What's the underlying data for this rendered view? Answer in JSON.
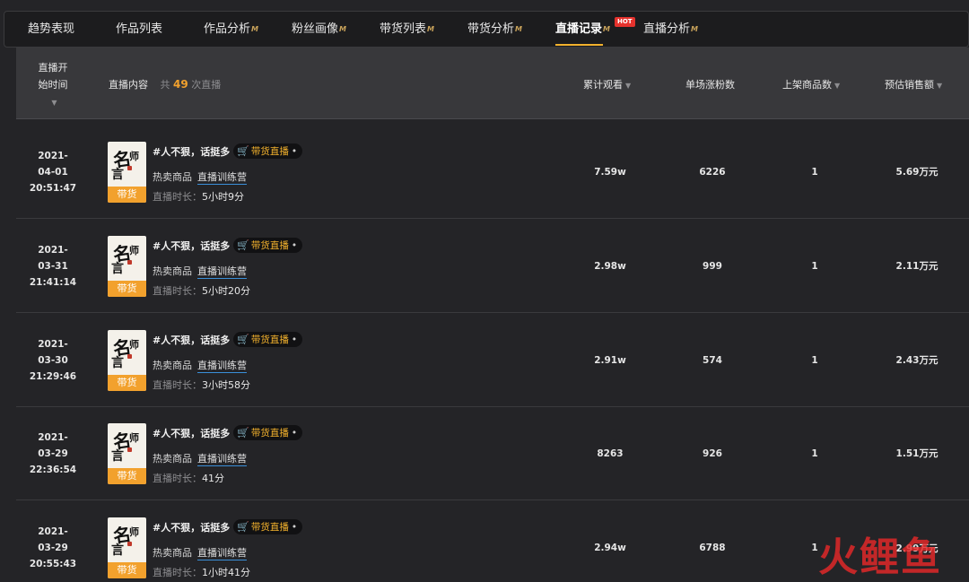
{
  "nav": {
    "tabs": [
      {
        "label": "趋势表现",
        "vip": false,
        "active": false
      },
      {
        "label": "作品列表",
        "vip": false,
        "active": false
      },
      {
        "label": "作品分析",
        "vip": true,
        "active": false
      },
      {
        "label": "粉丝画像",
        "vip": true,
        "active": false
      },
      {
        "label": "带货列表",
        "vip": true,
        "active": false
      },
      {
        "label": "带货分析",
        "vip": true,
        "active": false
      },
      {
        "label": "直播记录",
        "vip": true,
        "active": true
      },
      {
        "label": "直播分析",
        "vip": true,
        "active": false
      }
    ],
    "vip_mark": "M",
    "hot_badge": "HOT"
  },
  "table": {
    "headers": {
      "start_time": "直播开始时间",
      "content": "直播内容",
      "total_prefix": "共",
      "total_count": "49",
      "total_suffix": "次直播",
      "viewers": "累计观看",
      "fans_gain": "单场涨粉数",
      "products": "上架商品数",
      "sales": "预估销售额"
    },
    "caret": "▼",
    "rows": [
      {
        "date": "2021-",
        "md": "04-01",
        "time": "20:51:47",
        "title": "#人不狠，话挺多",
        "pill": "带货直播",
        "hot_label": "热卖商品",
        "hot_link": "直播训练营",
        "dur_label": "直播时长：",
        "duration": "5小时9分",
        "viewers": "7.59w",
        "fans": "6226",
        "products": "1",
        "sales": "5.69万元"
      },
      {
        "date": "2021-",
        "md": "03-31",
        "time": "21:41:14",
        "title": "#人不狠，话挺多",
        "pill": "带货直播",
        "hot_label": "热卖商品",
        "hot_link": "直播训练营",
        "dur_label": "直播时长：",
        "duration": "5小时20分",
        "viewers": "2.98w",
        "fans": "999",
        "products": "1",
        "sales": "2.11万元"
      },
      {
        "date": "2021-",
        "md": "03-30",
        "time": "21:29:46",
        "title": "#人不狠，话挺多",
        "pill": "带货直播",
        "hot_label": "热卖商品",
        "hot_link": "直播训练营",
        "dur_label": "直播时长：",
        "duration": "3小时58分",
        "viewers": "2.91w",
        "fans": "574",
        "products": "1",
        "sales": "2.43万元"
      },
      {
        "date": "2021-",
        "md": "03-29",
        "time": "22:36:54",
        "title": "#人不狠，话挺多",
        "pill": "带货直播",
        "hot_label": "热卖商品",
        "hot_link": "直播训练营",
        "dur_label": "直播时长：",
        "duration": "41分",
        "viewers": "8263",
        "fans": "926",
        "products": "1",
        "sales": "1.51万元"
      },
      {
        "date": "2021-",
        "md": "03-29",
        "time": "20:55:43",
        "title": "#人不狠，话挺多",
        "pill": "带货直播",
        "hot_label": "热卖商品",
        "hot_link": "直播训练营",
        "dur_label": "直播时长：",
        "duration": "1小时41分",
        "viewers": "2.94w",
        "fans": "6788",
        "products": "1",
        "sales": "2.99万元"
      }
    ],
    "thumb": {
      "band": "带货",
      "chars": [
        "名",
        "师",
        "言"
      ]
    }
  },
  "watermark": "火鲤鱼",
  "colors": {
    "accent": "#f2b12d",
    "hot": "#e5322d",
    "link_underline": "#3a8fd9",
    "bg": "#242427"
  }
}
